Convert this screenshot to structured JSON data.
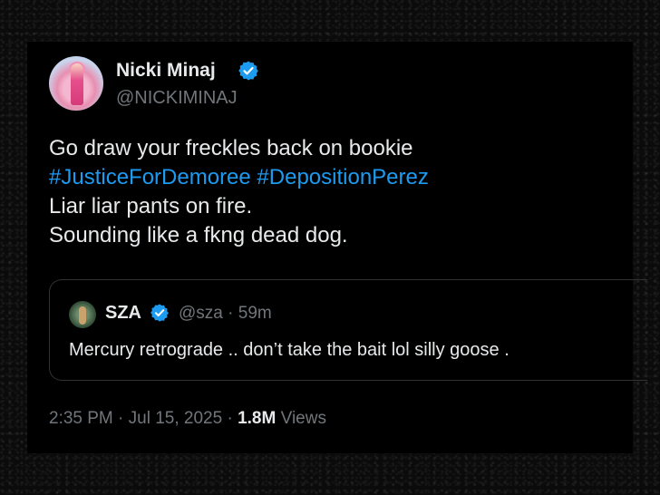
{
  "tweet": {
    "author": {
      "display_name": "Nicki Minaj",
      "handle": "@NICKIMINAJ",
      "verified": true
    },
    "text_lines": [
      "Go draw your freckles back on bookie"
    ],
    "hashtags": [
      "#JusticeForDemoree",
      "#DepositionPerez"
    ],
    "text_lines_after": [
      "Liar liar pants on fire.",
      "Sounding like a fkng dead dog."
    ],
    "quoted": {
      "display_name": "SZA",
      "handle": "@sza",
      "separator": "·",
      "age": "59m",
      "verified": true,
      "text": "Mercury retrograde .. don’t take the bait lol silly goose ."
    },
    "footer": {
      "time": "2:35 PM",
      "separator": "·",
      "date": "Jul 15, 2025",
      "views_count": "1.8M",
      "views_label": "Views"
    }
  },
  "colors": {
    "background": "#000000",
    "text": "#e7e9ea",
    "secondary": "#71767b",
    "link": "#1d9bf0",
    "verified": "#1d9bf0"
  },
  "icons": [
    "verified-badge-icon"
  ]
}
